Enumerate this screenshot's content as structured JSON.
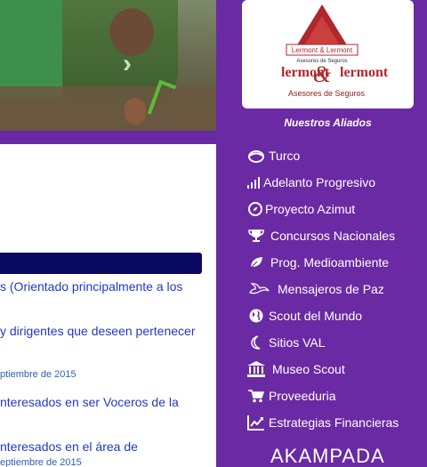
{
  "sidebar": {
    "allies_title": "Nuestros Aliados",
    "logo": {
      "top_text": "Lermont & Lermont",
      "mid_text": "Asesores de Seguros",
      "brand_left": "lermont",
      "brand_right": "lermont",
      "tagline": "Asesores de Seguros"
    },
    "items": [
      {
        "label": "Turco",
        "icon": "turban-icon"
      },
      {
        "label": "Adelanto Progresivo",
        "icon": "signal-bars-icon"
      },
      {
        "label": "Proyecto Azimut",
        "icon": "compass-icon"
      },
      {
        "label": "Concursos Nacionales",
        "icon": "trophy-icon"
      },
      {
        "label": "Prog. Medioambiente",
        "icon": "leaf-icon"
      },
      {
        "label": "Mensajeros de Paz",
        "icon": "dove-icon"
      },
      {
        "label": "Scout del Mundo",
        "icon": "globe-icon"
      },
      {
        "label": "Sitios VAL",
        "icon": "moon-icon"
      },
      {
        "label": "Museo Scout",
        "icon": "museum-icon"
      },
      {
        "label": "Proveeduria",
        "icon": "cart-icon"
      },
      {
        "label": "Estrategias Financieras",
        "icon": "chart-line-icon"
      }
    ],
    "footer_logo": "AKAMPADA"
  },
  "main": {
    "news": [
      {
        "text": "s (Orientado principalmente a los"
      },
      {
        "text": "y dirigentes que deseen pertenecer"
      },
      {
        "date": "ptiembre de 2015"
      },
      {
        "text": "nteresados en ser Voceros de la"
      },
      {
        "text": "nteresados en el área de"
      },
      {
        "date": "eptiembre de 2015"
      }
    ]
  },
  "colors": {
    "background": "#6a2aa3",
    "section_bar": "#0a0a63",
    "link": "#2238c9",
    "logo_red": "#b0282b"
  }
}
